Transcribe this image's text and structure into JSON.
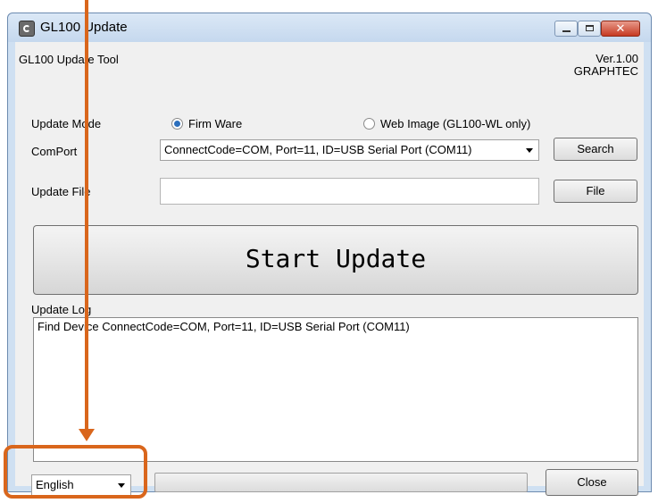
{
  "window": {
    "title": "GL100 Update"
  },
  "header": {
    "app_name": "GL100 Update Tool",
    "version": "Ver.1.00",
    "company": "GRAPHTEC"
  },
  "update_mode": {
    "label": "Update Mode",
    "options": [
      {
        "label": "Firm Ware",
        "selected": true
      },
      {
        "label": "Web Image (GL100-WL only)",
        "selected": false
      }
    ]
  },
  "com_port": {
    "label": "ComPort",
    "value": "ConnectCode=COM, Port=11, ID=USB Serial Port (COM11)",
    "search_button": "Search"
  },
  "update_file": {
    "label": "Update File",
    "value": "",
    "file_button": "File"
  },
  "start_button": "Start Update",
  "log": {
    "label": "Update Log",
    "lines": [
      "Find Device ConnectCode=COM, Port=11, ID=USB Serial Port (COM11)"
    ]
  },
  "footer": {
    "language": "English",
    "progress": 0,
    "close_button": "Close"
  },
  "colors": {
    "annotation": "#d9661c",
    "radio_selected": "#2c6fbd"
  }
}
